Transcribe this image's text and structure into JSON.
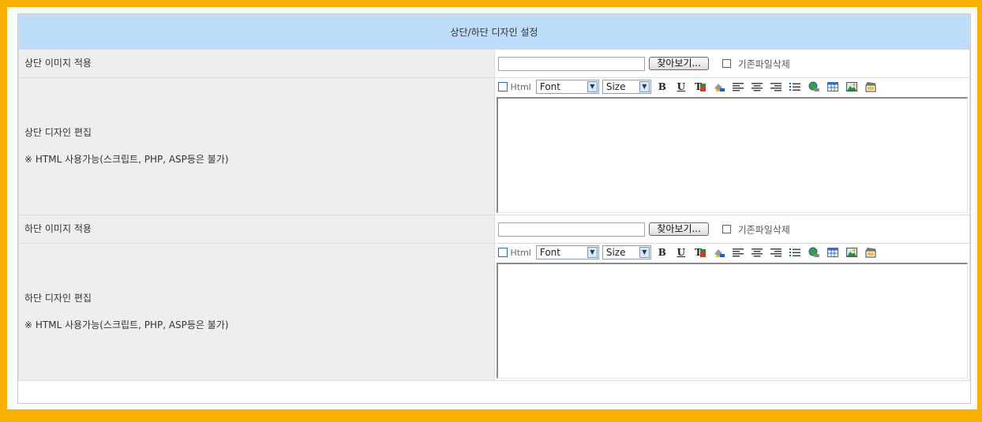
{
  "section_title": "상단/하단 디자인 설정",
  "top": {
    "image_label": "상단 이미지 적용",
    "browse_label": "찾아보기...",
    "delete_label": "기존파일삭제",
    "design_label": "상단 디자인 편집",
    "design_note": "※ HTML 사용가능(스크립트, PHP, ASP등은 불가)",
    "html_label": "Html",
    "font_select": "Font",
    "size_select": "Size",
    "editor_value": ""
  },
  "bottom": {
    "image_label": "하단 이미지 적용",
    "browse_label": "찾아보기...",
    "delete_label": "기존파일삭제",
    "design_label": "하단 디자인 편집",
    "design_note": "※ HTML 사용가능(스크립트, PHP, ASP등은 불가)",
    "html_label": "Html",
    "font_select": "Font",
    "size_select": "Size",
    "editor_value": ""
  },
  "toolbar_glyphs": {
    "bold": "B",
    "underline": "U"
  },
  "colors": {
    "frame": "#f8b000",
    "header_bg": "#bcdcfa",
    "label_bg": "#eeeeee"
  },
  "icons": [
    "text-color-icon",
    "highlight-icon",
    "align-left-icon",
    "align-center-icon",
    "align-right-icon",
    "bullet-list-icon",
    "link-icon",
    "table-icon",
    "image-icon",
    "media-icon"
  ]
}
